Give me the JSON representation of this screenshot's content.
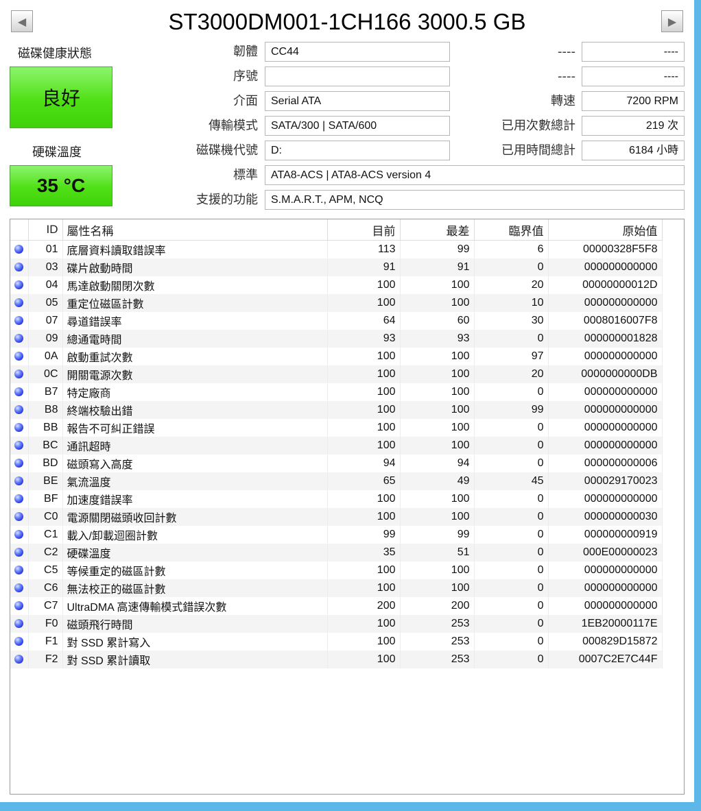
{
  "title": "ST3000DM001-1CH166 3000.5 GB",
  "nav": {
    "prev_icon": "triangle-left-icon",
    "next_icon": "triangle-right-icon"
  },
  "health": {
    "label": "磁碟健康狀態",
    "value": "良好",
    "color": "#50e016"
  },
  "temperature": {
    "label": "硬碟溫度",
    "value": "35 °C",
    "color": "#50e016"
  },
  "info_left": [
    {
      "label": "韌體",
      "value": "CC44"
    },
    {
      "label": "序號",
      "value": ""
    },
    {
      "label": "介面",
      "value": "Serial ATA"
    },
    {
      "label": "傳輸模式",
      "value": "SATA/300 | SATA/600"
    },
    {
      "label": "磁碟機代號",
      "value": "D:"
    }
  ],
  "info_right": [
    {
      "label": "----",
      "value": "----"
    },
    {
      "label": "----",
      "value": "----"
    },
    {
      "label": "轉速",
      "value": "7200 RPM"
    },
    {
      "label": "已用次數總計",
      "value": "219 次"
    },
    {
      "label": "已用時間總計",
      "value": "6184 小時"
    }
  ],
  "info_wide": [
    {
      "label": "標準",
      "value": "ATA8-ACS | ATA8-ACS version 4"
    },
    {
      "label": "支援的功能",
      "value": "S.M.A.R.T., APM, NCQ"
    }
  ],
  "smart_table": {
    "columns": [
      "",
      "ID",
      "屬性名稱",
      "目前",
      "最差",
      "臨界值",
      "原始值"
    ],
    "status_icon": "blue-status-dot-icon",
    "rows": [
      {
        "id": "01",
        "name": "底層資料讀取錯誤率",
        "current": "113",
        "worst": "99",
        "threshold": "6",
        "raw": "00000328F5F8"
      },
      {
        "id": "03",
        "name": "碟片啟動時間",
        "current": "91",
        "worst": "91",
        "threshold": "0",
        "raw": "000000000000"
      },
      {
        "id": "04",
        "name": "馬達啟動關閉次數",
        "current": "100",
        "worst": "100",
        "threshold": "20",
        "raw": "00000000012D"
      },
      {
        "id": "05",
        "name": "重定位磁區計數",
        "current": "100",
        "worst": "100",
        "threshold": "10",
        "raw": "000000000000"
      },
      {
        "id": "07",
        "name": "尋道錯誤率",
        "current": "64",
        "worst": "60",
        "threshold": "30",
        "raw": "0008016007F8"
      },
      {
        "id": "09",
        "name": "總通電時間",
        "current": "93",
        "worst": "93",
        "threshold": "0",
        "raw": "000000001828"
      },
      {
        "id": "0A",
        "name": "啟動重試次數",
        "current": "100",
        "worst": "100",
        "threshold": "97",
        "raw": "000000000000"
      },
      {
        "id": "0C",
        "name": "開關電源次數",
        "current": "100",
        "worst": "100",
        "threshold": "20",
        "raw": "0000000000DB"
      },
      {
        "id": "B7",
        "name": "特定廠商",
        "current": "100",
        "worst": "100",
        "threshold": "0",
        "raw": "000000000000"
      },
      {
        "id": "B8",
        "name": "終端校驗出錯",
        "current": "100",
        "worst": "100",
        "threshold": "99",
        "raw": "000000000000"
      },
      {
        "id": "BB",
        "name": "報告不可糾正錯誤",
        "current": "100",
        "worst": "100",
        "threshold": "0",
        "raw": "000000000000"
      },
      {
        "id": "BC",
        "name": "通訊超時",
        "current": "100",
        "worst": "100",
        "threshold": "0",
        "raw": "000000000000"
      },
      {
        "id": "BD",
        "name": "磁頭寫入高度",
        "current": "94",
        "worst": "94",
        "threshold": "0",
        "raw": "000000000006"
      },
      {
        "id": "BE",
        "name": "氣流溫度",
        "current": "65",
        "worst": "49",
        "threshold": "45",
        "raw": "000029170023"
      },
      {
        "id": "BF",
        "name": "加速度錯誤率",
        "current": "100",
        "worst": "100",
        "threshold": "0",
        "raw": "000000000000"
      },
      {
        "id": "C0",
        "name": "電源關閉磁頭收回計數",
        "current": "100",
        "worst": "100",
        "threshold": "0",
        "raw": "000000000030"
      },
      {
        "id": "C1",
        "name": "載入/卸載迴圈計數",
        "current": "99",
        "worst": "99",
        "threshold": "0",
        "raw": "000000000919"
      },
      {
        "id": "C2",
        "name": "硬碟溫度",
        "current": "35",
        "worst": "51",
        "threshold": "0",
        "raw": "000E00000023"
      },
      {
        "id": "C5",
        "name": "等候重定的磁區計數",
        "current": "100",
        "worst": "100",
        "threshold": "0",
        "raw": "000000000000"
      },
      {
        "id": "C6",
        "name": "無法校正的磁區計數",
        "current": "100",
        "worst": "100",
        "threshold": "0",
        "raw": "000000000000"
      },
      {
        "id": "C7",
        "name": "UltraDMA 高速傳輸模式錯誤次數",
        "current": "200",
        "worst": "200",
        "threshold": "0",
        "raw": "000000000000"
      },
      {
        "id": "F0",
        "name": "磁頭飛行時間",
        "current": "100",
        "worst": "253",
        "threshold": "0",
        "raw": "1EB20000117E"
      },
      {
        "id": "F1",
        "name": "對 SSD 累計寫入",
        "current": "100",
        "worst": "253",
        "threshold": "0",
        "raw": "000829D15872"
      },
      {
        "id": "F2",
        "name": "對 SSD 累計讀取",
        "current": "100",
        "worst": "253",
        "threshold": "0",
        "raw": "0007C2E7C44F"
      }
    ]
  }
}
